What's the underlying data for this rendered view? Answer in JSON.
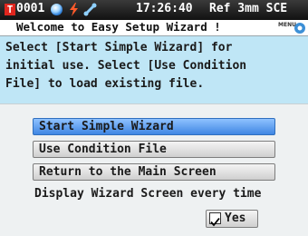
{
  "status_bar": {
    "counter": "0001",
    "clock": "17:26:40",
    "mode": "Ref 3mm SCE",
    "icons": [
      "target-icon",
      "sphere-icon",
      "battery-charge-icon",
      "connection-icon"
    ]
  },
  "title_bar": {
    "title": "Welcome to Easy Setup Wizard !",
    "menu_label": "MENU"
  },
  "message": {
    "text": "Select [Start Simple Wizard] for\ninitial use. Select [Use Condition\nFile] to load existing file."
  },
  "buttons": {
    "start_wizard": "Start Simple Wizard",
    "use_condition_file": "Use Condition File",
    "return_main": "Return to the Main Screen"
  },
  "display_option": {
    "label": "Display Wizard Screen every time",
    "value_label": "Yes",
    "checked": true
  },
  "colors": {
    "status_bg": "#111111",
    "message_bg": "#bfe6f6",
    "active_button": "#3f86e3",
    "accent_red": "#e0261e"
  }
}
